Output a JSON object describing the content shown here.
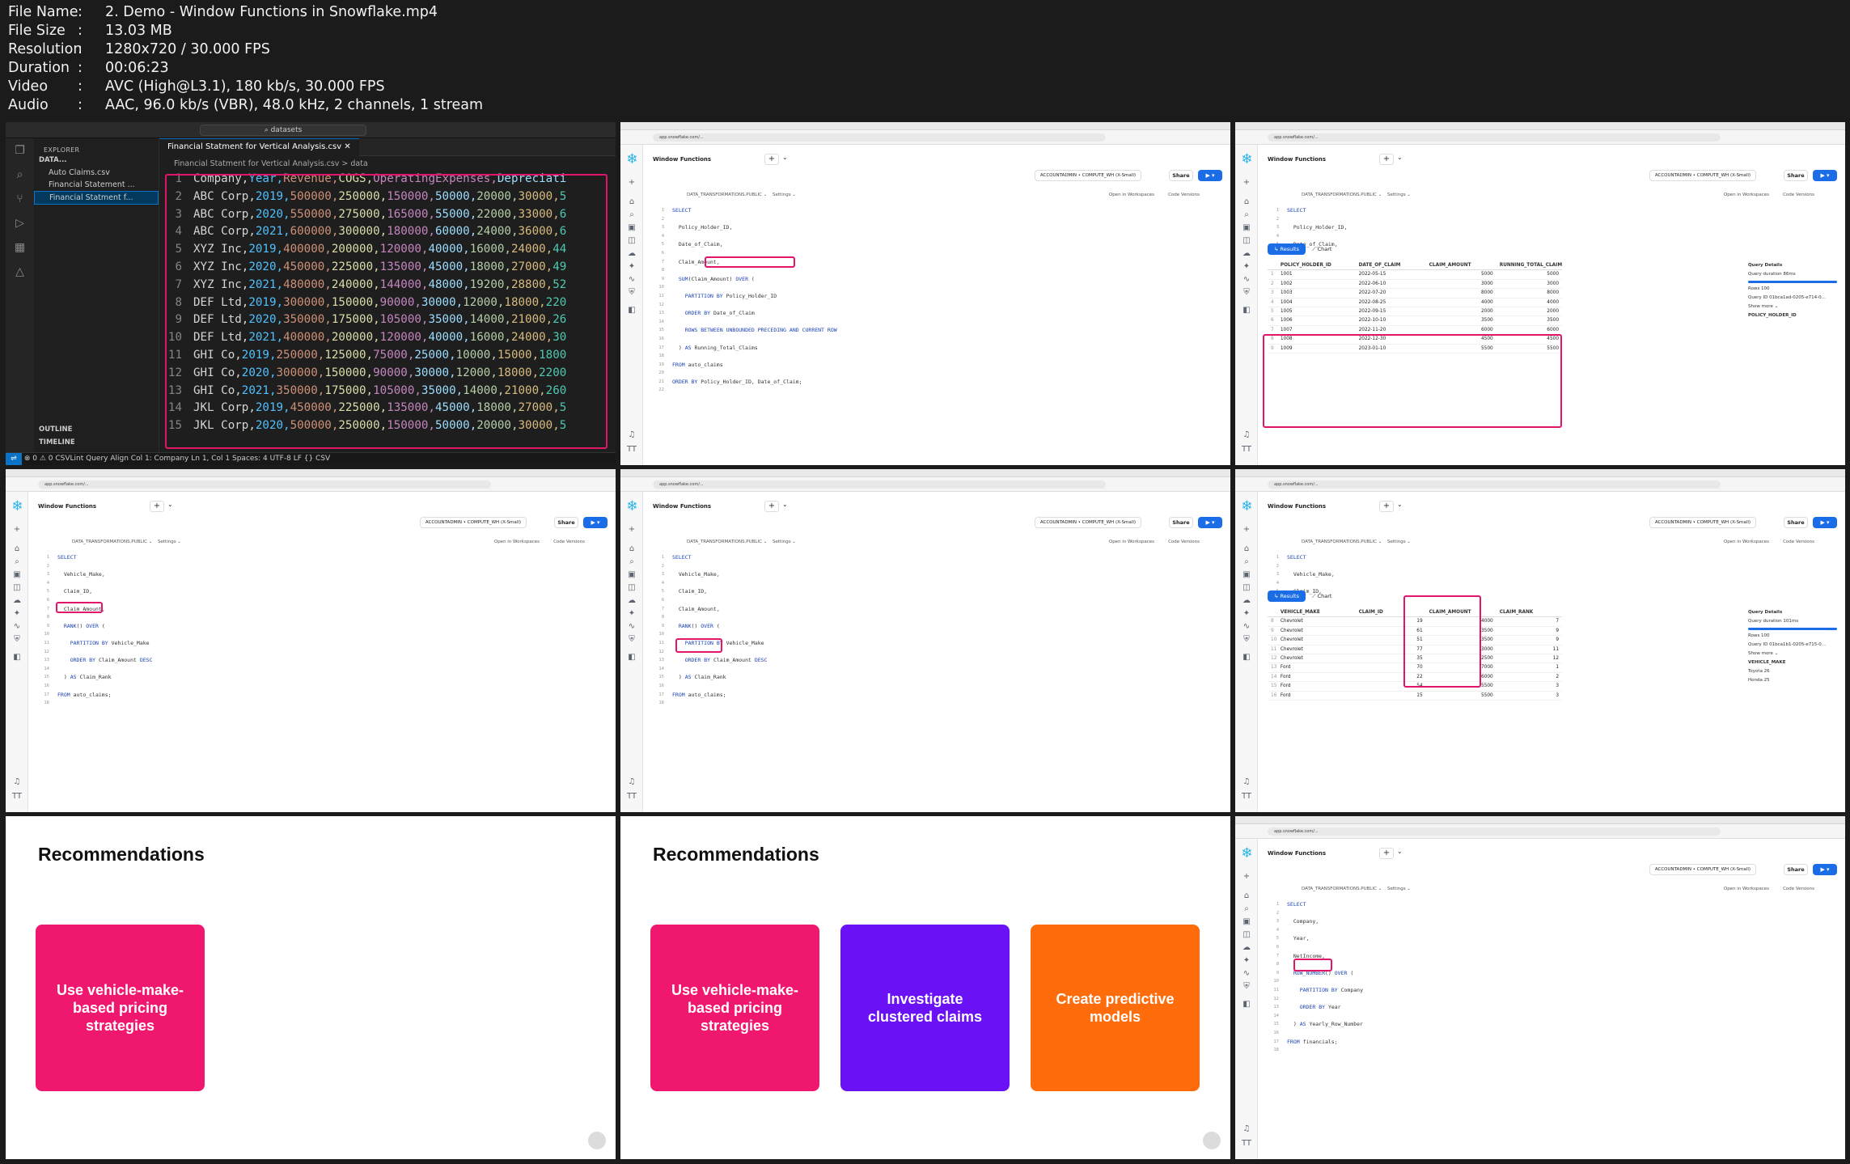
{
  "meta": {
    "rows": [
      {
        "k": "File Name",
        "v": "2. Demo - Window Functions in Snowflake.mp4"
      },
      {
        "k": "File Size",
        "v": "13.03 MB"
      },
      {
        "k": "Resolution",
        "v": "1280x720 / 30.000 FPS"
      },
      {
        "k": "Duration",
        "v": "00:06:23"
      },
      {
        "k": "Video",
        "v": "AVC (High@L3.1), 180 kb/s, 30.000 FPS"
      },
      {
        "k": "Audio",
        "v": "AAC, 96.0 kb/s (VBR), 48.0 kHz, 2 channels, 1 stream"
      }
    ]
  },
  "colors": {
    "accent": "#e2156b",
    "snow_blue": "#1a6ce7",
    "pink": "#f0176f",
    "purple": "#6a11f5",
    "orange": "#ff6c0b"
  },
  "vscode": {
    "search": "datasets",
    "explorer": "EXPLORER",
    "folder": "DATA...",
    "files": [
      "Auto Claims.csv",
      "Financial Statement ...",
      "Financial Statment f..."
    ],
    "outline": "OUTLINE",
    "timeline": "TIMELINE",
    "tab": "Financial Statment for Vertical Analysis.csv",
    "crumb": "Financial Statment for Vertical Analysis.csv > data",
    "lines": [
      "Company,Year,Revenue,COGS,OperatingExpenses,Depreciati",
      "ABC Corp,2019,500000,250000,150000,50000,20000,30000,5",
      "ABC Corp,2020,550000,275000,165000,55000,22000,33000,6",
      "ABC Corp,2021,600000,300000,180000,60000,24000,36000,6",
      "XYZ Inc,2019,400000,200000,120000,40000,16000,24000,44",
      "XYZ Inc,2020,450000,225000,135000,45000,18000,27000,49",
      "XYZ Inc,2021,480000,240000,144000,48000,19200,28800,52",
      "DEF Ltd,2019,300000,150000,90000,30000,12000,18000,220",
      "DEF Ltd,2020,350000,175000,105000,35000,14000,21000,26",
      "DEF Ltd,2021,400000,200000,120000,40000,16000,24000,30",
      "GHI Co,2019,250000,125000,75000,25000,10000,15000,1800",
      "GHI Co,2020,300000,150000,90000,30000,12000,18000,2200",
      "GHI Co,2021,350000,175000,105000,35000,14000,21000,260",
      "JKL Corp,2019,450000,225000,135000,45000,18000,27000,5",
      "JKL Corp,2020,500000,250000,150000,50000,20000,30000,5"
    ],
    "status": "⊗ 0 ⚠ 0   CSVLint   Query   Align            Col 1: Company      Ln 1, Col 1   Spaces: 4   UTF-8   LF   {} CSV"
  },
  "snowflake": {
    "url": "app.snowflake.com/...",
    "title": "Window Functions",
    "role": "ACCOUNTADMIN  •  COMPUTE_WH (X-Small)",
    "share": "Share",
    "run": "▶ ▾",
    "schema": "DATA_TRANSFORMATIONS.PUBLIC ⌄",
    "settings": "Settings ⌄",
    "open_ws": "Open in Workspaces",
    "code_versions": "Code Versions",
    "results_tab": "Results",
    "chart_tab": "Chart",
    "query1": [
      "SELECT",
      "  Policy_Holder_ID,",
      "  Date_of_Claim,",
      "  Claim_Amount,",
      "  SUM(Claim_Amount) OVER (",
      "    PARTITION BY Policy_Holder_ID",
      "    ORDER BY Date_of_Claim",
      "    ROWS BETWEEN UNBOUNDED PRECEDING AND CURRENT ROW",
      "  ) AS Running_Total_Claims",
      "FROM auto_claims",
      "ORDER BY Policy_Holder_ID, Date_of_Claim;"
    ],
    "query2": [
      "SELECT",
      "  Vehicle_Make,",
      "  Claim_ID,",
      "  Claim_Amount,",
      "  RANK() OVER (",
      "    PARTITION BY Vehicle_Make",
      "    ORDER BY Claim_Amount DESC",
      "  ) AS Claim_Rank",
      "FROM auto_claims;"
    ],
    "query3": [
      "SELECT",
      "  Company,",
      "  Year,",
      "  NetIncome,",
      "  ROW_NUMBER() OVER (",
      "    PARTITION BY Company",
      "    ORDER BY Year",
      "  ) AS Yearly_Row_Number",
      "FROM financials;"
    ],
    "grid1": {
      "headers": [
        "POLICY_HOLDER_ID",
        "DATE_OF_CLAIM",
        "CLAIM_AMOUNT",
        "RUNNING_TOTAL_CLAIMS"
      ],
      "rows": [
        [
          "1001",
          "2022-05-15",
          "5000",
          "5000"
        ],
        [
          "1002",
          "2022-06-10",
          "3000",
          "3000"
        ],
        [
          "1003",
          "2022-07-20",
          "8000",
          "8000"
        ],
        [
          "1004",
          "2022-08-25",
          "4000",
          "4000"
        ],
        [
          "1005",
          "2022-09-15",
          "2000",
          "2000"
        ],
        [
          "1006",
          "2022-10-10",
          "3500",
          "3500"
        ],
        [
          "1007",
          "2022-11-20",
          "6000",
          "6000"
        ],
        [
          "1008",
          "2022-12-30",
          "4500",
          "4500"
        ],
        [
          "1009",
          "2023-01-10",
          "5500",
          "5500"
        ]
      ]
    },
    "grid2": {
      "headers": [
        "VEHICLE_MAKE",
        "CLAIM_ID",
        "CLAIM_AMOUNT",
        "CLAIM_RANK"
      ],
      "rows": [
        [
          "Chevrolet",
          "19",
          "4000",
          "7"
        ],
        [
          "Chevrolet",
          "61",
          "3500",
          "9"
        ],
        [
          "Chevrolet",
          "51",
          "3500",
          "9"
        ],
        [
          "Chevrolet",
          "77",
          "3000",
          "11"
        ],
        [
          "Chevrolet",
          "35",
          "2500",
          "12"
        ],
        [
          "Ford",
          "70",
          "7000",
          "1"
        ],
        [
          "Ford",
          "22",
          "6000",
          "2"
        ],
        [
          "Ford",
          "54",
          "5500",
          "3"
        ],
        [
          "Ford",
          "15",
          "5500",
          "3"
        ]
      ]
    },
    "qd1": {
      "title": "Query Details",
      "dur": "Query duration",
      "dur_v": "86ms",
      "rows": "Rows",
      "rows_v": "100",
      "qid": "Query ID",
      "qid_v": "01bca1ad-0205-e714-0...",
      "more": "Show more ⌄",
      "col": "POLICY_HOLDER_ID"
    },
    "qd2": {
      "title": "Query Details",
      "dur": "Query duration",
      "dur_v": "101ms",
      "rows": "Rows",
      "rows_v": "100",
      "qid": "Query ID",
      "qid_v": "01bca1b1-0205-e715-0...",
      "more": "Show more ⌄",
      "col": "VEHICLE_MAKE",
      "v1": "Toyota",
      "v1n": "26",
      "v2": "Honda",
      "v2n": "25"
    }
  },
  "slides": {
    "title": "Recommendations",
    "c1": "Use vehicle-make-based pricing strategies",
    "c2": "Investigate clustered claims",
    "c3": "Create predictive models"
  }
}
